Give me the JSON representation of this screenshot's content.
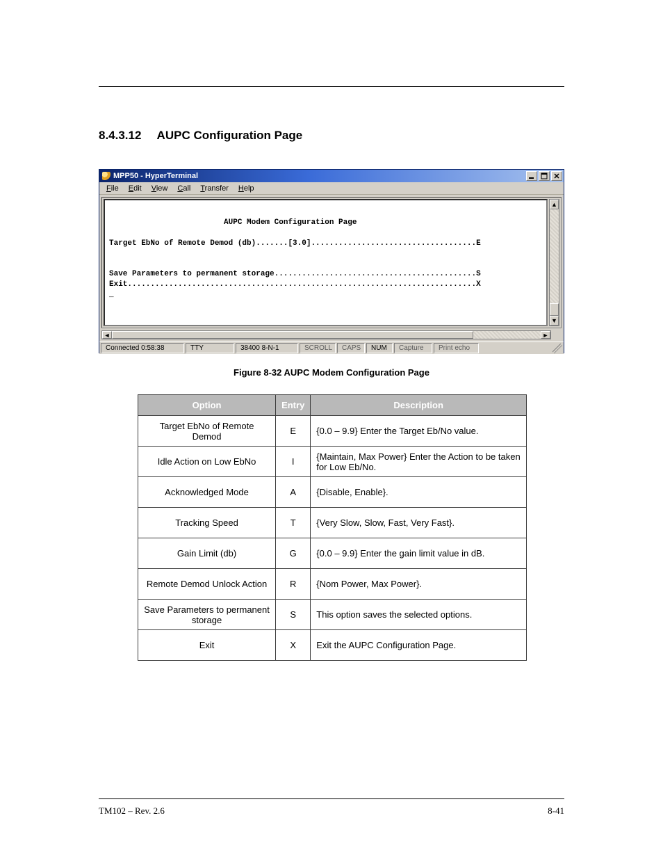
{
  "section": {
    "number": "8.4.3.12",
    "title": "AUPC Configuration Page"
  },
  "window": {
    "title": "MPP50 - HyperTerminal",
    "menus": [
      "File",
      "Edit",
      "View",
      "Call",
      "Transfer",
      "Help"
    ],
    "menu_underlines": [
      "F",
      "E",
      "V",
      "C",
      "T",
      "H"
    ],
    "status": {
      "connected": "Connected 0:58:38",
      "emulation": "TTY",
      "settings": "38400 8-N-1",
      "scroll": "SCROLL",
      "caps": "CAPS",
      "num": "NUM",
      "capture": "Capture",
      "print_echo": "Print echo"
    }
  },
  "terminal": {
    "title_line": "                         AUPC Modem Configuration Page",
    "lines": [
      "Target EbNo of Remote Demod (db).......[3.0]....................................E",
      "",
      "",
      "Save Parameters to permanent storage............................................S",
      "Exit............................................................................X",
      "_"
    ]
  },
  "figure_caption": "Figure 8-32 AUPC Modem Configuration Page",
  "options_table": {
    "headers": [
      "Option",
      "Entry",
      "Description"
    ],
    "rows": [
      {
        "option": "Target EbNo of Remote\nDemod",
        "key": "E",
        "desc": "{0.0 – 9.9} Enter the Target Eb/No value."
      },
      {
        "option": "Idle Action on Low EbNo",
        "key": "I",
        "desc": "{Maintain, Max Power} Enter the Action to be taken for Low Eb/No."
      },
      {
        "option": "Acknowledged Mode",
        "key": "A",
        "desc": "{Disable, Enable}."
      },
      {
        "option": "Tracking Speed",
        "key": "T",
        "desc": "{Very Slow, Slow, Fast, Very Fast}."
      },
      {
        "option": "Gain Limit (db)",
        "key": "G",
        "desc": "{0.0 – 9.9} Enter the gain limit value in dB."
      },
      {
        "option": "Remote Demod Unlock Action",
        "key": "R",
        "desc": "{Nom Power, Max Power}."
      },
      {
        "option": "Save Parameters to permanent storage",
        "key": "S",
        "desc": "This option saves the selected options."
      },
      {
        "option": "Exit",
        "key": "X",
        "desc": "Exit the AUPC Configuration Page."
      }
    ]
  },
  "footer": {
    "doc": "TM102 – Rev. 2.6",
    "page": "8-41"
  }
}
